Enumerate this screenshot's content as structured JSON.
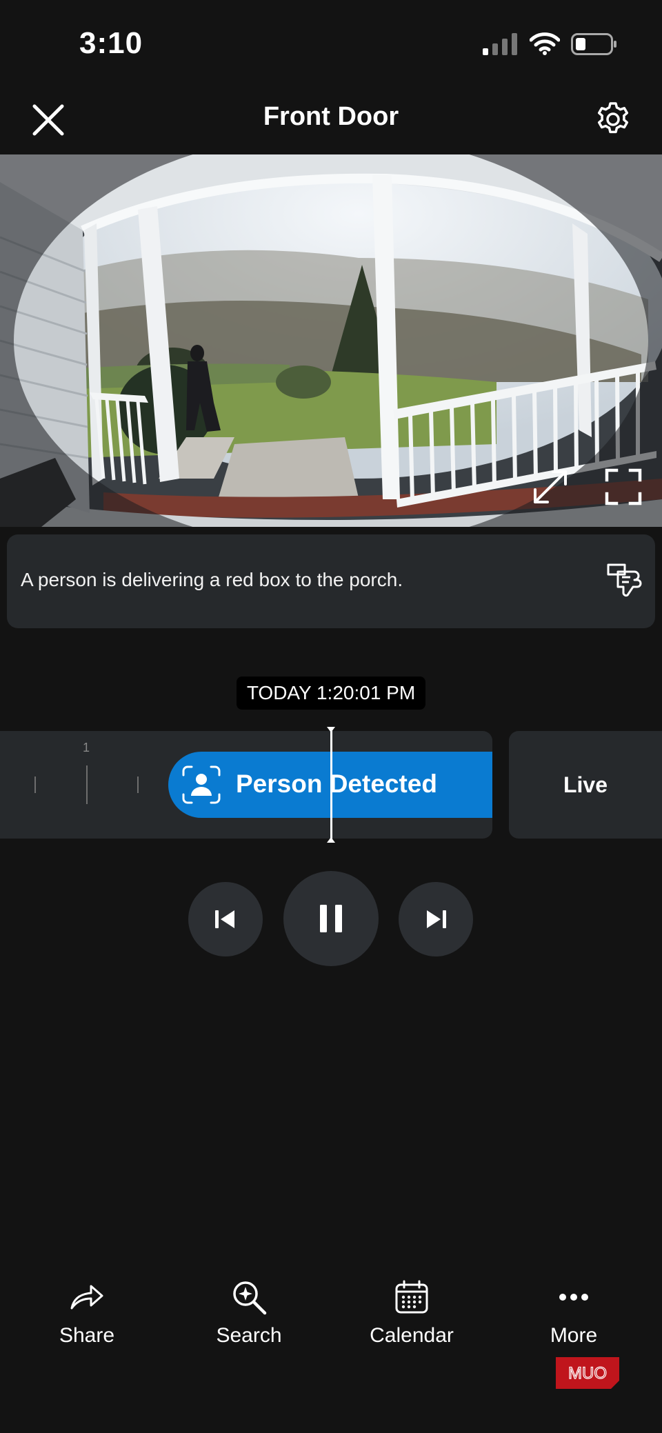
{
  "status_bar": {
    "time": "3:10"
  },
  "header": {
    "title": "Front Door"
  },
  "video": {
    "expand_icon": "expand-arrows-icon",
    "fullscreen_icon": "fullscreen-corners-icon"
  },
  "description": {
    "text": "A person is delivering a red box to the porch."
  },
  "timestamp": "TODAY 1:20:01 PM",
  "timeline": {
    "tick_label": "1",
    "event_label": "Person Detected",
    "live_label": "Live"
  },
  "bottom_nav": {
    "share": "Share",
    "search": "Search",
    "calendar": "Calendar",
    "more": "More"
  },
  "watermark": "MUO",
  "colors": {
    "accent": "#0a7bd1",
    "background": "#131313",
    "card": "#26292c"
  }
}
